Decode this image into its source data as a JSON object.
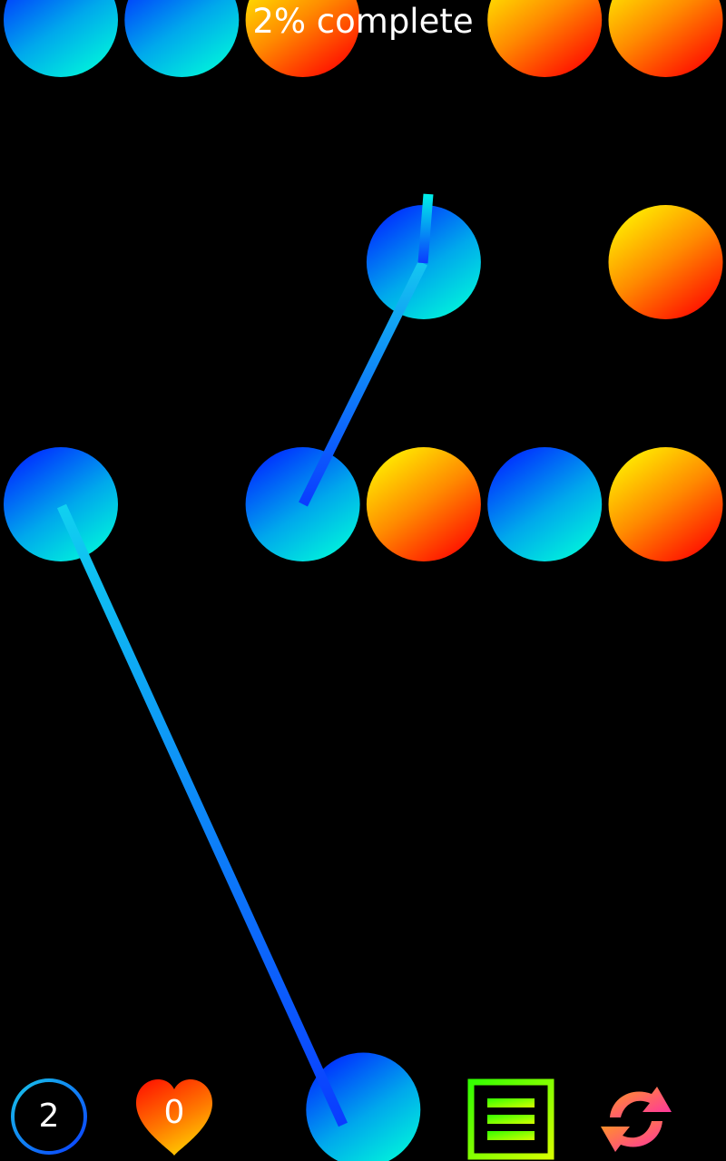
{
  "hud": {
    "progress_text": "2% complete",
    "moves": "2",
    "lives": "0"
  },
  "colors": {
    "background": "#000000",
    "blue_light": "#00e5e0",
    "blue_dark": "#0030ff",
    "red_light": "#ffee00",
    "red_dark": "#ff1100",
    "line_light": "#10c8f0",
    "line_dark": "#0a3cff",
    "menu_green": "#33ff00",
    "menu_yellow": "#d4ff00",
    "restart_orange": "#ff8a2a",
    "restart_pink": "#ff3ea0"
  },
  "icons": {
    "moves": "ring-icon",
    "lives": "heart-icon",
    "menu": "menu-icon",
    "restart": "restart-icon"
  },
  "board": {
    "balls": [
      {
        "color": "blue",
        "row": 0,
        "col": 0
      },
      {
        "color": "blue",
        "row": 0,
        "col": 1
      },
      {
        "color": "red",
        "row": 0,
        "col": 2
      },
      {
        "color": "red",
        "row": 0,
        "col": 4
      },
      {
        "color": "red",
        "row": 0,
        "col": 5
      },
      {
        "color": "blue",
        "row": 2,
        "col": 3
      },
      {
        "color": "red",
        "row": 2,
        "col": 5
      },
      {
        "color": "blue",
        "row": 4,
        "col": 0
      },
      {
        "color": "blue",
        "row": 4,
        "col": 2
      },
      {
        "color": "red",
        "row": 4,
        "col": 3
      },
      {
        "color": "blue",
        "row": 4,
        "col": 4
      },
      {
        "color": "red",
        "row": 4,
        "col": 5
      },
      {
        "color": "blue",
        "row": 9,
        "col": 2.5
      }
    ]
  }
}
